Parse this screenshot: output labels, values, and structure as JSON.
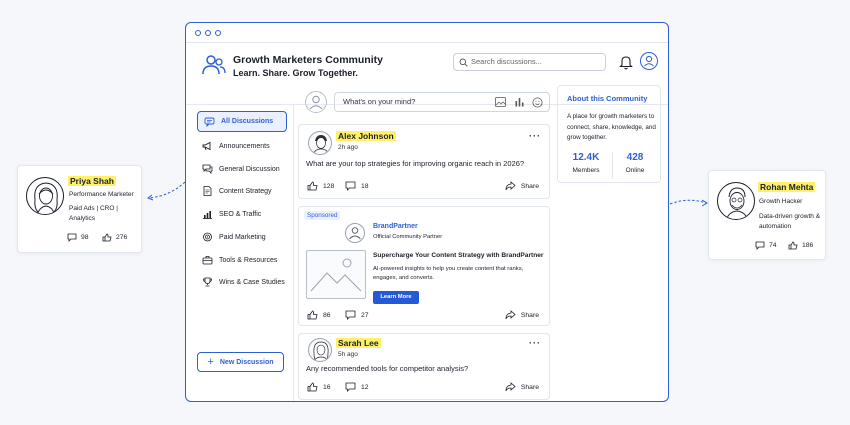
{
  "app": {
    "title": "Growth Marketers Community",
    "tagline": "Learn. Share. Grow Together.",
    "search_placeholder": "Search discussions..."
  },
  "sidebar": {
    "items": [
      {
        "label": "All Discussions",
        "icon": "chat-bubble-icon",
        "active": true
      },
      {
        "label": "Announcements",
        "icon": "megaphone-icon"
      },
      {
        "label": "General Discussion",
        "icon": "chat-icon"
      },
      {
        "label": "Content Strategy",
        "icon": "document-icon"
      },
      {
        "label": "SEO & Traffic",
        "icon": "chart-icon"
      },
      {
        "label": "Paid Marketing",
        "icon": "target-icon"
      },
      {
        "label": "Tools & Resources",
        "icon": "briefcase-icon"
      },
      {
        "label": "Wins & Case Studies",
        "icon": "trophy-icon"
      }
    ],
    "new_discussion": "New Discussion"
  },
  "composer": {
    "placeholder": "What's on your mind?"
  },
  "posts": [
    {
      "author": "Alex Johnson",
      "time": "2h ago",
      "text": "What are your top strategies for improving organic reach in 2026?",
      "likes": "128",
      "comments": "18",
      "share": "Share"
    },
    {
      "author": "Sarah Lee",
      "time": "5h ago",
      "text": "Any recommended tools for competitor analysis?",
      "likes": "16",
      "comments": "12",
      "share": "Share"
    }
  ],
  "sponsored": {
    "badge": "Sponsored",
    "brand": "BrandPartner",
    "brand_sub": "Official Community Partner",
    "title": "Supercharge Your Content Strategy with BrandPartner",
    "desc": "AI-powered insights to help you create content that ranks, engages, and converts.",
    "cta": "Learn More",
    "likes": "86",
    "comments": "27",
    "share": "Share"
  },
  "about": {
    "title": "About this Community",
    "desc": "A place for growth marketers to connect, share, knowledge, and grow together.",
    "members_value": "12.4K",
    "members_label": "Members",
    "online_value": "428",
    "online_label": "Online"
  },
  "profiles": {
    "left": {
      "name": "Priya Shah",
      "role": "Performance Marketer",
      "desc": "Paid Ads | CRO | Analytics",
      "comments": "98",
      "likes": "276"
    },
    "right": {
      "name": "Rohan Mehta",
      "role": "Growth Hacker",
      "desc": "Data-driven growth & automation",
      "comments": "74",
      "likes": "186"
    }
  },
  "colors": {
    "accent": "#2d5fd3",
    "highlight": "#fff06a",
    "cta": "#2559d8"
  }
}
